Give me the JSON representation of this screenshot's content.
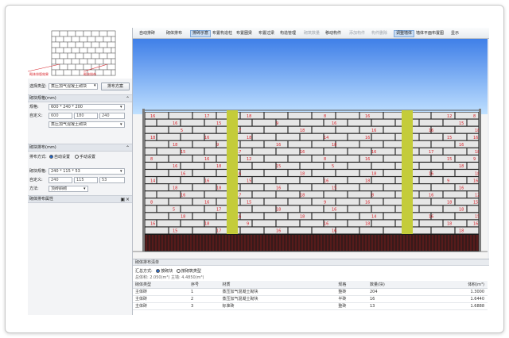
{
  "left_panel": {
    "preview_label_left": "砌体排版效果",
    "preview_label_right": "砌块排布",
    "type_label": "选择类型:",
    "type_value": "蒸压加气混凝土砌块",
    "layout_button": "排布方案",
    "section1": {
      "title": "砌块规格(mm)",
      "rows": [
        {
          "label": "规格:",
          "value": "600 * 240 * 200"
        },
        {
          "label": "自定义:",
          "values": [
            "600",
            "180",
            "240"
          ]
        },
        {
          "label": "",
          "value": "蒸压加气混凝土砌块"
        }
      ]
    },
    "section2": {
      "title": "砌块排布(mm)",
      "mode_label": "排布方式:",
      "modes": [
        "自动设置",
        "手动设置"
      ],
      "rows": [
        {
          "label": "砌块规格:",
          "value": "240 * 115 * 53"
        },
        {
          "label": "自定义:",
          "values": [
            "240",
            "115",
            "53"
          ]
        },
        {
          "label": "方法:",
          "value": "顶砖斜砌"
        }
      ]
    },
    "section3": {
      "title": "砌体排布属性"
    }
  },
  "tabs": [
    {
      "label": "自动排砖",
      "state": "normal"
    },
    {
      "label": "砌体排布",
      "state": "normal"
    },
    {
      "label": "排砖示意",
      "state": "active"
    },
    {
      "label": "布置构造柱",
      "state": "normal"
    },
    {
      "label": "布置圈梁",
      "state": "normal"
    },
    {
      "label": "布置过梁",
      "state": "normal"
    },
    {
      "label": "构造管理",
      "state": "normal"
    },
    {
      "label": "砌筑数量",
      "state": "dim"
    },
    {
      "label": "移动构件",
      "state": "normal"
    },
    {
      "label": "添加构件",
      "state": "dim"
    },
    {
      "label": "构件删除",
      "state": "dim"
    },
    {
      "label": "调整墙体",
      "state": "active"
    },
    {
      "label": "墙体平面布置图",
      "state": "normal"
    },
    {
      "label": "显示",
      "state": "normal"
    }
  ],
  "wall": {
    "block_numbers": [
      "16",
      "17",
      "18",
      "8",
      "16",
      "12",
      "8",
      "16",
      "15",
      "9",
      "16",
      "18",
      "15",
      "5",
      "17",
      "18",
      "16",
      "16",
      "18",
      "18",
      "16",
      "18",
      "14",
      "16",
      "15",
      "16",
      "18",
      "9",
      "16",
      "18",
      "18",
      "16",
      "15",
      "17",
      "16"
    ],
    "colors": {
      "sky_top": "#3f7fe8",
      "sky_bottom": "#bfe0ff",
      "block": "#e6e6e6",
      "mortar": "#2b2b2b",
      "column": "#c4cc3a",
      "label": "#d8222a",
      "base": "#1a1a1a"
    }
  },
  "lower_panel": {
    "header": "砌体排布清单",
    "view_label": "汇总方式:",
    "options": [
      "按砌块",
      "按砌筑类型"
    ],
    "summary": "总体积: 2.050(m³) 主墙: 4.4850(m³)",
    "columns": [
      "砌体类型",
      "序号",
      "材质",
      "规格",
      "数量(块)",
      "体积(m³)"
    ],
    "rows": [
      [
        "主体砖",
        "1",
        "蒸压加气混凝土砌块",
        "整砖",
        "204",
        "1.3000"
      ],
      [
        "主体砖",
        "2",
        "蒸压加气混凝土砌块",
        "半砖",
        "16",
        "1.6440"
      ],
      [
        "主体砖",
        "3",
        "标准砖",
        "整砖",
        "13",
        "1.6888"
      ]
    ]
  }
}
